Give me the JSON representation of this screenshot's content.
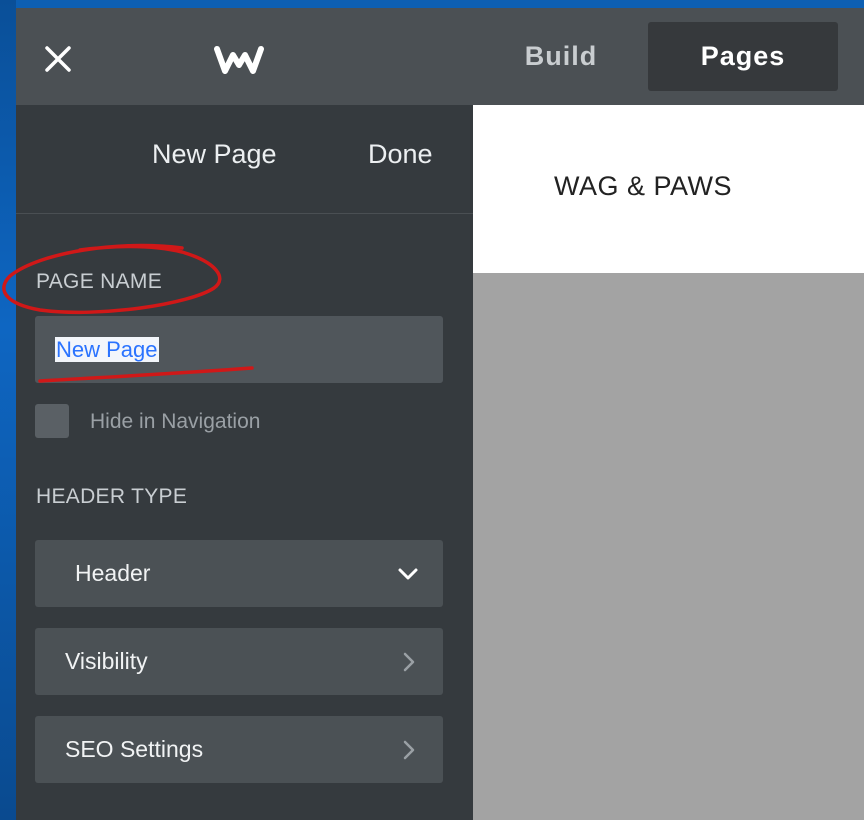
{
  "topbar": {
    "close_icon": "close-icon",
    "logo_icon": "weebly-logo-icon",
    "tabs": [
      {
        "label": "Build",
        "active": false
      },
      {
        "label": "Pages",
        "active": true
      }
    ]
  },
  "sidebar": {
    "title": "New Page",
    "done_label": "Done",
    "page_name_label": "PAGE NAME",
    "page_name_value": "New Page",
    "hide_nav_label": "Hide in Navigation",
    "hide_nav_checked": false,
    "header_type_label": "HEADER TYPE",
    "header_type_selected": "Header",
    "rows": [
      {
        "label": "Visibility",
        "icon": "chevron-right-icon"
      },
      {
        "label": "SEO Settings",
        "icon": "chevron-right-icon"
      }
    ]
  },
  "preview": {
    "site_title": "WAG & PAWS"
  },
  "colors": {
    "topbar_bg": "#4b5054",
    "sidebar_bg": "#353a3e",
    "annotation_red": "#d01818",
    "selection_text": "#2a73ff"
  }
}
